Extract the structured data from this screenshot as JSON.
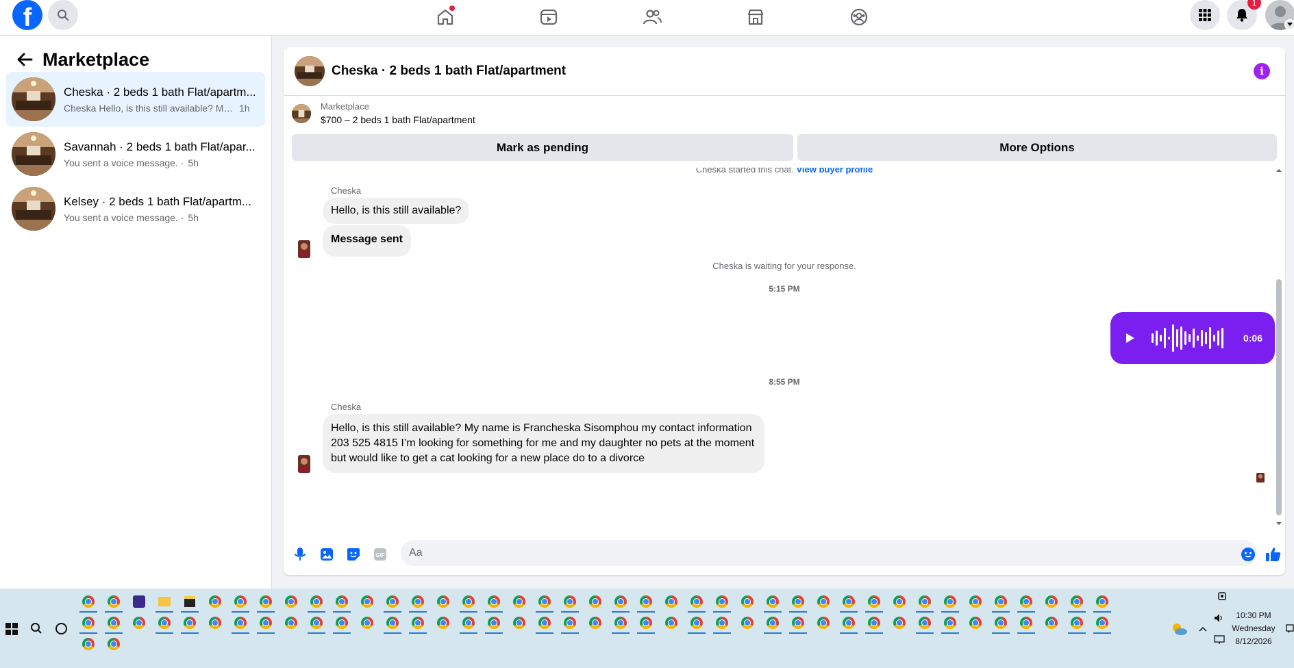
{
  "topbar": {
    "logo_text": "f",
    "notification_count": "1",
    "nav_icons": [
      "home-icon",
      "video-icon",
      "friends-icon",
      "marketplace-icon",
      "groups-icon"
    ]
  },
  "sidebar": {
    "title": "Marketplace",
    "conversations": [
      {
        "title": "Cheska · 2 beds 1 bath Flat/apartm...",
        "preview": "Cheska Hello, is this still available? My...",
        "time": "1h",
        "active": true
      },
      {
        "title": "Savannah · 2 beds 1 bath Flat/apar...",
        "preview": "You sent a voice message. ·",
        "time": "5h",
        "active": false
      },
      {
        "title": "Kelsey · 2 beds 1 bath Flat/apartm...",
        "preview": "You sent a voice message. ·",
        "time": "5h",
        "active": false
      }
    ]
  },
  "chat": {
    "title": "Cheska · 2 beds 1 bath Flat/apartment",
    "listing_label": "Marketplace",
    "listing_price": "$700 – 2 beds 1 bath Flat/apartment",
    "pending_button": "Mark as pending",
    "more_button": "More Options",
    "started_text": "Cheska started this chat.",
    "buyer_profile_link": "View buyer profile",
    "sender_name": "Cheska",
    "msg1": "Hello, is this still available?",
    "msg2": "Message sent",
    "waiting_text": "Cheska is waiting for your response.",
    "time1": "5:15 PM",
    "voice_duration": "0:06",
    "time2": "8:55 PM",
    "msg3": "Hello, is this still available? My name is Francheska Sisomphou my contact information 203 525 4815 I’m looking for something for me and my daughter no pets at the moment but would like to get a cat looking for a new place do to a divorce",
    "composer_placeholder": "Aa"
  },
  "taskbar": {
    "time": "10:30 PM",
    "day": "Wednesday",
    "date": "8/12/2026"
  },
  "colors": {
    "facebook_blue": "#0866ff",
    "voice_bubble": "#7a1ff0",
    "active_conversation": "#e7f3ff",
    "notification_red": "#e41e3f"
  }
}
